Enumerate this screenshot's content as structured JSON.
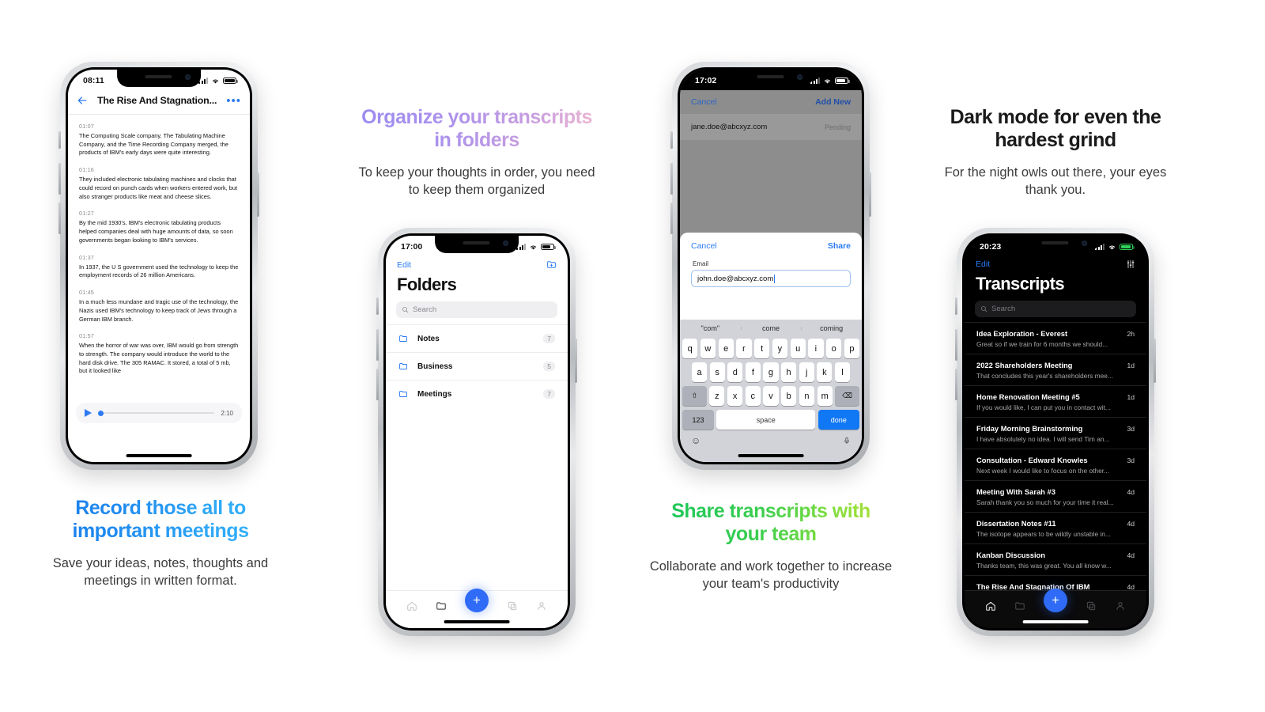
{
  "panels": [
    {
      "id": "record",
      "title": "Record those all to important meetings",
      "subtitle": "Save your ideas, notes, thoughts and meetings in written format."
    },
    {
      "id": "organize",
      "title": "Organize your transcripts in folders",
      "subtitle": "To keep your thoughts in order, you need to keep them organized"
    },
    {
      "id": "share",
      "title": "Share transcripts with your team",
      "subtitle": "Collaborate and work together to increase your team's productivity"
    },
    {
      "id": "dark",
      "title": "Dark mode for even the hardest grind",
      "subtitle": "For the night owls out there, your eyes thank you."
    }
  ],
  "phone_transcript": {
    "status": {
      "time": "08:11",
      "signal": "signal-icon",
      "wifi": "wifi-icon",
      "battery": "battery-icon"
    },
    "nav": {
      "back": "back-arrow-icon",
      "title": "The Rise And Stagnation...",
      "more": "more-options-icon"
    },
    "segments": [
      {
        "time": "01:07",
        "text": "The Computing Scale company, The Tabulating Machine Company, and the Time Recording Company merged, the products of IBM's early days were quite interesting."
      },
      {
        "time": "01:16",
        "text": "They included electronic tabulating machines and clocks that could record on punch cards when workers entered work, but also stranger products like meat and cheese slices."
      },
      {
        "time": "01:27",
        "text": "By the mid 1930's, IBM's electronic tabulating products helped companies deal with huge amounts of data, so soon governments began looking to IBM's services."
      },
      {
        "time": "01:37",
        "text": "In 1937, the U S government used the technology to keep the employment records of 26 million Americans."
      },
      {
        "time": "01:45",
        "text": "In a much less mundane and tragic use of the technology, the Nazis used IBM's technology to keep track of Jews through a German IBM branch."
      },
      {
        "time": "01:57",
        "text": "When the horror of war was over, IBM would go from strength to strength. The company would introduce the world to the hard disk drive. The 305 RAMAC. It stored, a total of 5 mb, but it looked like"
      }
    ],
    "player": {
      "play": "play-icon",
      "duration": "2:10",
      "progress": 0
    }
  },
  "phone_folders": {
    "status": {
      "time": "17:00"
    },
    "topbar": {
      "edit": "Edit",
      "new_folder": "new-folder-icon"
    },
    "title": "Folders",
    "search_placeholder": "Search",
    "folders": [
      {
        "name": "Notes",
        "count": "7"
      },
      {
        "name": "Business",
        "count": "5"
      },
      {
        "name": "Meetings",
        "count": "7"
      }
    ],
    "tabs": [
      "home-icon",
      "folder-icon",
      "add-icon",
      "copy-icon",
      "profile-icon"
    ],
    "active_tab": "folder-icon"
  },
  "phone_share": {
    "status": {
      "time": "17:02"
    },
    "background_nav": {
      "cancel": "Cancel",
      "add_new": "Add New"
    },
    "recipients": [
      {
        "email": "jane.doe@abcxyz.com",
        "status": "Pending"
      }
    ],
    "sheet": {
      "cancel": "Cancel",
      "share": "Share",
      "field_label": "Email",
      "field_value": "john.doe@abcxyz.com"
    },
    "keyboard": {
      "suggestions": [
        "\"com\"",
        "come",
        "coming"
      ],
      "row1": [
        "q",
        "w",
        "e",
        "r",
        "t",
        "y",
        "u",
        "i",
        "o",
        "p"
      ],
      "row2": [
        "a",
        "s",
        "d",
        "f",
        "g",
        "h",
        "j",
        "k",
        "l"
      ],
      "row3_shift": "shift-icon",
      "row3": [
        "z",
        "x",
        "c",
        "v",
        "b",
        "n",
        "m"
      ],
      "row3_delete": "delete-icon",
      "numbers": "123",
      "space": "space",
      "done": "done",
      "emoji": "emoji-icon",
      "mic": "microphone-icon"
    }
  },
  "phone_dark": {
    "status": {
      "time": "20:23"
    },
    "topbar": {
      "edit": "Edit",
      "filter": "filter-sliders-icon"
    },
    "title": "Transcripts",
    "search_placeholder": "Search",
    "transcripts": [
      {
        "name": "Idea Exploration - Everest",
        "when": "2h",
        "preview": "Great so if we train for 6 months we should..."
      },
      {
        "name": "2022 Shareholders Meeting",
        "when": "1d",
        "preview": "That concludes this year's shareholders mee..."
      },
      {
        "name": "Home Renovation Meeting #5",
        "when": "1d",
        "preview": "If you would like, I can put you in contact wit..."
      },
      {
        "name": "Friday Morning Brainstorming",
        "when": "3d",
        "preview": "I have absolutely no idea. I will send Tim an..."
      },
      {
        "name": "Consultation - Edward Knowles",
        "when": "3d",
        "preview": "Next week I would like to focus on the other..."
      },
      {
        "name": "Meeting With Sarah #3",
        "when": "4d",
        "preview": "Sarah thank you so much for your time it real..."
      },
      {
        "name": "Dissertation Notes #11",
        "when": "4d",
        "preview": "The isotope appears to be wildly unstable in..."
      },
      {
        "name": "Kanban Discussion",
        "when": "4d",
        "preview": "Thanks team, this was great. You all know w..."
      },
      {
        "name": "The Rise And Stagnation Of IBM",
        "when": "4d",
        "preview": ""
      }
    ],
    "tabs": [
      "home-icon",
      "folder-icon",
      "add-icon",
      "copy-icon",
      "profile-icon"
    ],
    "active_tab": "home-icon"
  },
  "colors": {
    "accent": "#2f6bf6",
    "blue_link": "#2b7bf3",
    "dark_bg": "#000000"
  }
}
